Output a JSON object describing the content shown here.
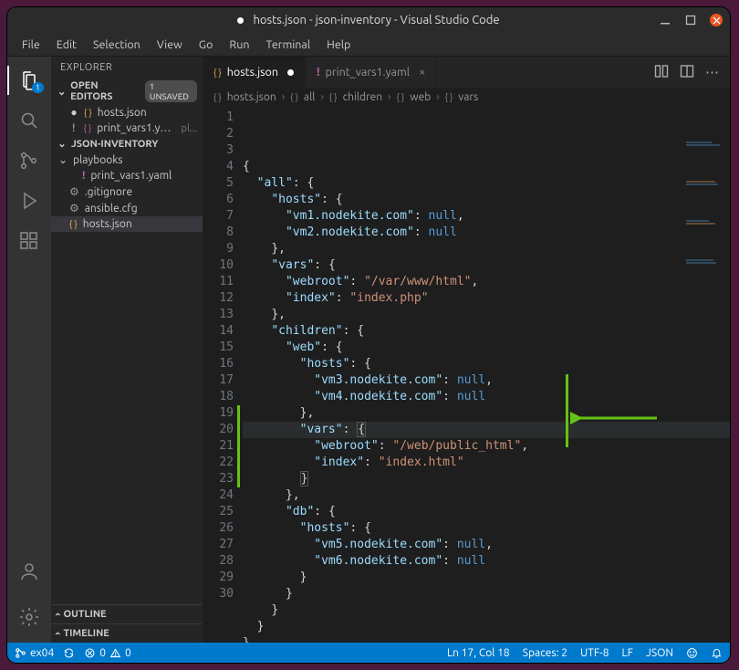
{
  "titlebar": {
    "title": "hosts.json - json-inventory - Visual Studio Code"
  },
  "menu": [
    "File",
    "Edit",
    "Selection",
    "View",
    "Go",
    "Run",
    "Terminal",
    "Help"
  ],
  "sidebar": {
    "title": "EXPLORER",
    "openEditors": {
      "label": "OPEN EDITORS",
      "badge": "1 UNSAVED"
    },
    "openItems": [
      {
        "name": "hosts.json",
        "dirty": true,
        "icon": "json"
      },
      {
        "name": "print_vars1.yaml",
        "suffix": "pl...",
        "marker": "!",
        "icon": "yaml"
      }
    ],
    "project": {
      "label": "JSON-INVENTORY"
    },
    "tree": [
      {
        "label": "playbooks",
        "type": "folder",
        "indent": 0
      },
      {
        "label": "print_vars1.yaml",
        "type": "yaml",
        "indent": 1,
        "marker": "!"
      },
      {
        "label": ".gitignore",
        "type": "gear",
        "indent": 0
      },
      {
        "label": "ansible.cfg",
        "type": "gear",
        "indent": 0
      },
      {
        "label": "hosts.json",
        "type": "json",
        "indent": 0,
        "selected": true
      }
    ],
    "outline": "OUTLINE",
    "timeline": "TIMELINE"
  },
  "tabs": {
    "items": [
      {
        "label": "hosts.json",
        "icon": "json",
        "active": true,
        "dirty": true
      },
      {
        "label": "print_vars1.yaml",
        "icon": "yaml",
        "active": false,
        "marker": "!"
      }
    ]
  },
  "breadcrumb": [
    "hosts.json",
    "all",
    "children",
    "web",
    "vars"
  ],
  "code": {
    "lines": [
      [
        {
          "t": "brace",
          "v": "{"
        }
      ],
      [
        {
          "t": "sp",
          "v": "  "
        },
        {
          "t": "key",
          "v": "\"all\""
        },
        {
          "t": "punc",
          "v": ": "
        },
        {
          "t": "brace",
          "v": "{"
        }
      ],
      [
        {
          "t": "sp",
          "v": "    "
        },
        {
          "t": "key",
          "v": "\"hosts\""
        },
        {
          "t": "punc",
          "v": ": "
        },
        {
          "t": "brace",
          "v": "{"
        }
      ],
      [
        {
          "t": "sp",
          "v": "      "
        },
        {
          "t": "key",
          "v": "\"vm1.nodekite.com\""
        },
        {
          "t": "punc",
          "v": ": "
        },
        {
          "t": "null",
          "v": "null"
        },
        {
          "t": "punc",
          "v": ","
        }
      ],
      [
        {
          "t": "sp",
          "v": "      "
        },
        {
          "t": "key",
          "v": "\"vm2.nodekite.com\""
        },
        {
          "t": "punc",
          "v": ": "
        },
        {
          "t": "null",
          "v": "null"
        }
      ],
      [
        {
          "t": "sp",
          "v": "    "
        },
        {
          "t": "brace",
          "v": "}"
        },
        {
          "t": "punc",
          "v": ","
        }
      ],
      [
        {
          "t": "sp",
          "v": "    "
        },
        {
          "t": "key",
          "v": "\"vars\""
        },
        {
          "t": "punc",
          "v": ": "
        },
        {
          "t": "brace",
          "v": "{"
        }
      ],
      [
        {
          "t": "sp",
          "v": "      "
        },
        {
          "t": "key",
          "v": "\"webroot\""
        },
        {
          "t": "punc",
          "v": ": "
        },
        {
          "t": "str",
          "v": "\"/var/www/html\""
        },
        {
          "t": "punc",
          "v": ","
        }
      ],
      [
        {
          "t": "sp",
          "v": "      "
        },
        {
          "t": "key",
          "v": "\"index\""
        },
        {
          "t": "punc",
          "v": ": "
        },
        {
          "t": "str",
          "v": "\"index.php\""
        }
      ],
      [
        {
          "t": "sp",
          "v": "    "
        },
        {
          "t": "brace",
          "v": "}"
        },
        {
          "t": "punc",
          "v": ","
        }
      ],
      [
        {
          "t": "sp",
          "v": "    "
        },
        {
          "t": "key",
          "v": "\"children\""
        },
        {
          "t": "punc",
          "v": ": "
        },
        {
          "t": "brace",
          "v": "{"
        }
      ],
      [
        {
          "t": "sp",
          "v": "      "
        },
        {
          "t": "key",
          "v": "\"web\""
        },
        {
          "t": "punc",
          "v": ": "
        },
        {
          "t": "brace",
          "v": "{"
        }
      ],
      [
        {
          "t": "sp",
          "v": "        "
        },
        {
          "t": "key",
          "v": "\"hosts\""
        },
        {
          "t": "punc",
          "v": ": "
        },
        {
          "t": "brace",
          "v": "{"
        }
      ],
      [
        {
          "t": "sp",
          "v": "          "
        },
        {
          "t": "key",
          "v": "\"vm3.nodekite.com\""
        },
        {
          "t": "punc",
          "v": ": "
        },
        {
          "t": "null",
          "v": "null"
        },
        {
          "t": "punc",
          "v": ","
        }
      ],
      [
        {
          "t": "sp",
          "v": "          "
        },
        {
          "t": "key",
          "v": "\"vm4.nodekite.com\""
        },
        {
          "t": "punc",
          "v": ": "
        },
        {
          "t": "null",
          "v": "null"
        }
      ],
      [
        {
          "t": "sp",
          "v": "        "
        },
        {
          "t": "brace",
          "v": "}"
        },
        {
          "t": "punc",
          "v": ","
        }
      ],
      [
        {
          "t": "sp",
          "v": "        "
        },
        {
          "t": "key",
          "v": "\"vars\""
        },
        {
          "t": "punc",
          "v": ": "
        },
        {
          "t": "bracematch",
          "v": "{"
        }
      ],
      [
        {
          "t": "sp",
          "v": "          "
        },
        {
          "t": "key",
          "v": "\"webroot\""
        },
        {
          "t": "punc",
          "v": ": "
        },
        {
          "t": "str",
          "v": "\"/web/public_html\""
        },
        {
          "t": "punc",
          "v": ","
        }
      ],
      [
        {
          "t": "sp",
          "v": "          "
        },
        {
          "t": "key",
          "v": "\"index\""
        },
        {
          "t": "punc",
          "v": ": "
        },
        {
          "t": "str",
          "v": "\"index.html\""
        }
      ],
      [
        {
          "t": "sp",
          "v": "        "
        },
        {
          "t": "bracematch",
          "v": "}"
        }
      ],
      [
        {
          "t": "sp",
          "v": "      "
        },
        {
          "t": "brace",
          "v": "}"
        },
        {
          "t": "punc",
          "v": ","
        }
      ],
      [
        {
          "t": "sp",
          "v": "      "
        },
        {
          "t": "key",
          "v": "\"db\""
        },
        {
          "t": "punc",
          "v": ": "
        },
        {
          "t": "brace",
          "v": "{"
        }
      ],
      [
        {
          "t": "sp",
          "v": "        "
        },
        {
          "t": "key",
          "v": "\"hosts\""
        },
        {
          "t": "punc",
          "v": ": "
        },
        {
          "t": "brace",
          "v": "{"
        }
      ],
      [
        {
          "t": "sp",
          "v": "          "
        },
        {
          "t": "key",
          "v": "\"vm5.nodekite.com\""
        },
        {
          "t": "punc",
          "v": ": "
        },
        {
          "t": "null",
          "v": "null"
        },
        {
          "t": "punc",
          "v": ","
        }
      ],
      [
        {
          "t": "sp",
          "v": "          "
        },
        {
          "t": "key",
          "v": "\"vm6.nodekite.com\""
        },
        {
          "t": "punc",
          "v": ": "
        },
        {
          "t": "null",
          "v": "null"
        }
      ],
      [
        {
          "t": "sp",
          "v": "        "
        },
        {
          "t": "brace",
          "v": "}"
        }
      ],
      [
        {
          "t": "sp",
          "v": "      "
        },
        {
          "t": "brace",
          "v": "}"
        }
      ],
      [
        {
          "t": "sp",
          "v": "    "
        },
        {
          "t": "brace",
          "v": "}"
        }
      ],
      [
        {
          "t": "sp",
          "v": "  "
        },
        {
          "t": "brace",
          "v": "}"
        }
      ],
      [
        {
          "t": "brace",
          "v": "}"
        }
      ]
    ],
    "highlightLine": 17,
    "diffLines": [
      16,
      17,
      18,
      19,
      20
    ]
  },
  "status": {
    "branch": "ex04",
    "sync": "",
    "errors": "0",
    "warnings": "0",
    "lncol": "Ln 17, Col 18",
    "spaces": "Spaces: 2",
    "encoding": "UTF-8",
    "eol": "LF",
    "lang": "JSON"
  }
}
